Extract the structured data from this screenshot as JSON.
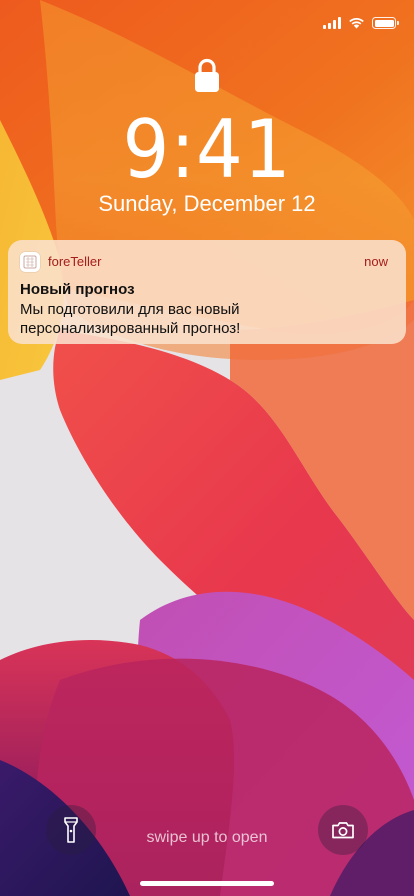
{
  "status_bar": {
    "signal_icon": "cellular-signal-icon",
    "wifi_icon": "wifi-icon",
    "battery_icon": "battery-icon",
    "battery_level": 1.0
  },
  "lock_screen": {
    "lock_icon": "lock-icon",
    "time": "9:41",
    "date": "Sunday, December 12"
  },
  "notification": {
    "app_icon": "foreteller-app-icon",
    "app_name": "foreTeller",
    "time": "now",
    "title": "Новый прогноз",
    "body": "Мы подготовили для вас новый персонализированный прогноз!",
    "accent_color": "#a51d1d"
  },
  "bottom": {
    "flashlight_icon": "flashlight-icon",
    "camera_icon": "camera-icon",
    "swipe_hint": "swipe up to open"
  }
}
